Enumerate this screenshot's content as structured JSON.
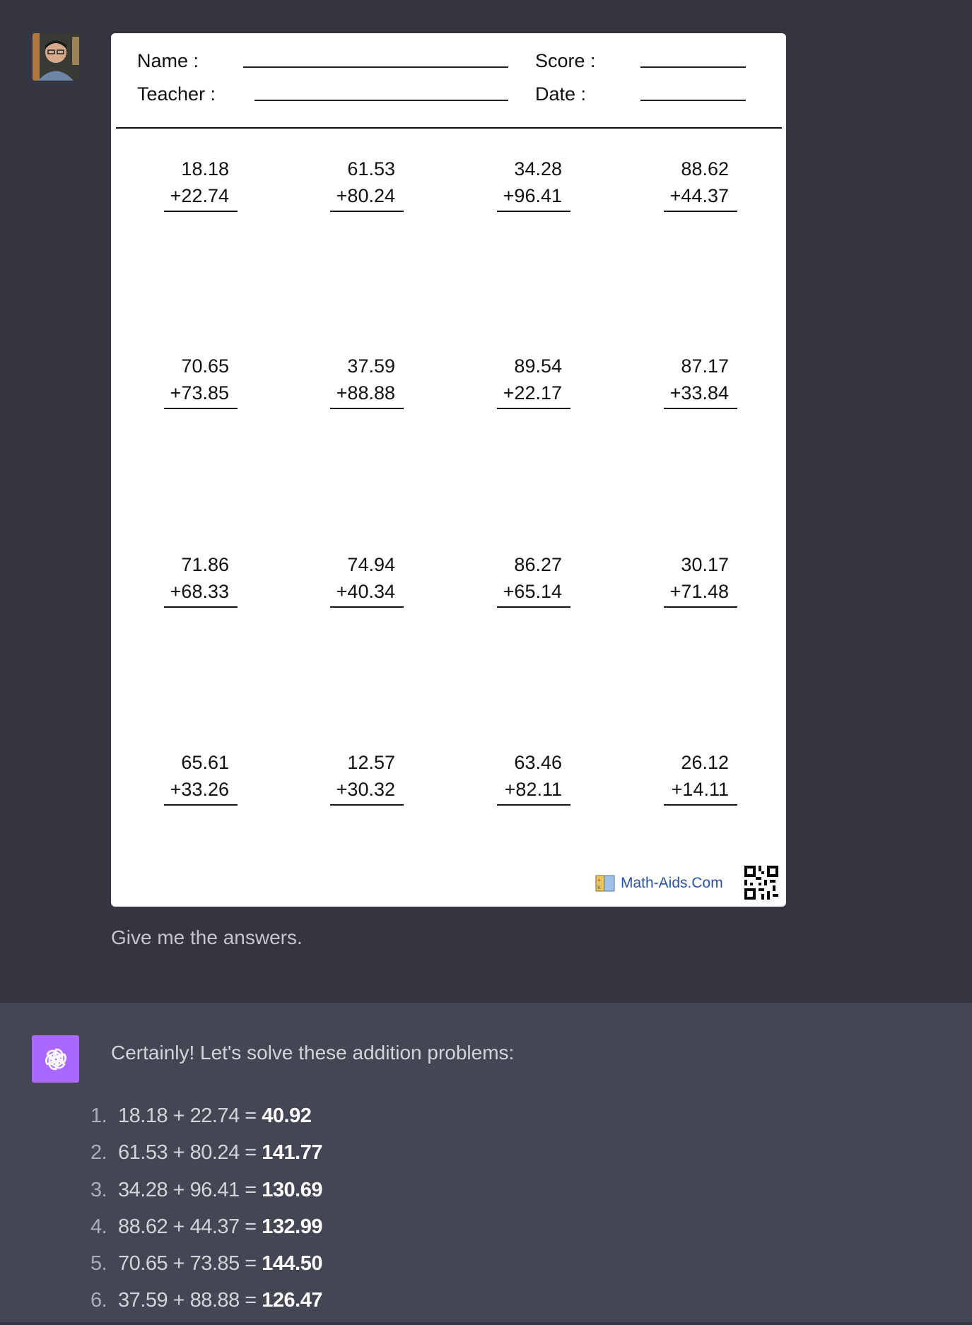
{
  "worksheet": {
    "name_label": "Name :",
    "teacher_label": "Teacher :",
    "score_label": "Score :",
    "date_label": "Date :",
    "problems": [
      {
        "a": "18.18",
        "b": "+22.74"
      },
      {
        "a": "61.53",
        "b": "+80.24"
      },
      {
        "a": "34.28",
        "b": "+96.41"
      },
      {
        "a": "88.62",
        "b": "+44.37"
      },
      {
        "a": "70.65",
        "b": "+73.85"
      },
      {
        "a": "37.59",
        "b": "+88.88"
      },
      {
        "a": "89.54",
        "b": "+22.17"
      },
      {
        "a": "87.17",
        "b": "+33.84"
      },
      {
        "a": "71.86",
        "b": "+68.33"
      },
      {
        "a": "74.94",
        "b": "+40.34"
      },
      {
        "a": "86.27",
        "b": "+65.14"
      },
      {
        "a": "30.17",
        "b": "+71.48"
      },
      {
        "a": "65.61",
        "b": "+33.26"
      },
      {
        "a": "12.57",
        "b": "+30.32"
      },
      {
        "a": "63.46",
        "b": "+82.11"
      },
      {
        "a": "26.12",
        "b": "+14.11"
      }
    ],
    "footer_brand": "Math-Aids.Com",
    "brand_color": "#2c52a7"
  },
  "user_message": {
    "text": "Give me the answers."
  },
  "assistant_message": {
    "intro": "Certainly! Let's solve these addition problems:",
    "avatar_color": "#ab68ff",
    "answers": [
      {
        "num": "1.",
        "expr": "18.18 + 22.74 = ",
        "result": "40.92"
      },
      {
        "num": "2.",
        "expr": "61.53 + 80.24 = ",
        "result": "141.77"
      },
      {
        "num": "3.",
        "expr": "34.28 + 96.41 = ",
        "result": "130.69"
      },
      {
        "num": "4.",
        "expr": "88.62 + 44.37 = ",
        "result": "132.99"
      },
      {
        "num": "5.",
        "expr": "70.65 + 73.85 = ",
        "result": "144.50"
      },
      {
        "num": "6.",
        "expr": "37.59 + 88.88 = ",
        "result": "126.47"
      }
    ]
  },
  "icons": {
    "user_avatar": "user-photo-avatar",
    "assistant_avatar": "openai-logo-icon",
    "qr": "qr-code-icon",
    "brand": "math-aids-logo-icon"
  }
}
